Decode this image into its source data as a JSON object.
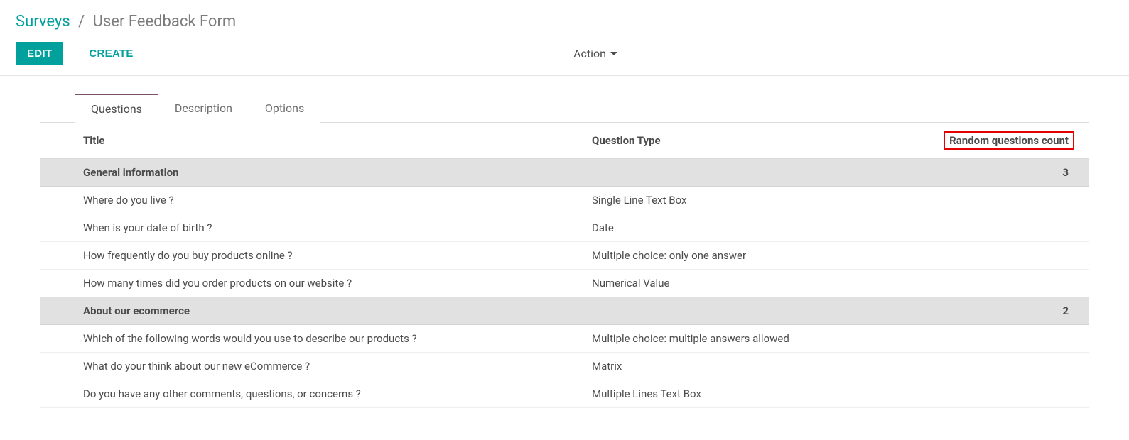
{
  "breadcrumb": {
    "parent": "Surveys",
    "current": "User Feedback Form"
  },
  "toolbar": {
    "edit_label": "EDIT",
    "create_label": "CREATE",
    "action_label": "Action"
  },
  "tabs": {
    "questions": "Questions",
    "description": "Description",
    "options": "Options"
  },
  "table": {
    "headers": {
      "title": "Title",
      "question_type": "Question Type",
      "random_count": "Random questions count"
    },
    "sections": [
      {
        "name": "General information",
        "random_count": "3",
        "rows": [
          {
            "title": "Where do you live ?",
            "type": "Single Line Text Box"
          },
          {
            "title": "When is your date of birth ?",
            "type": "Date"
          },
          {
            "title": "How frequently do you buy products online ?",
            "type": "Multiple choice: only one answer"
          },
          {
            "title": "How many times did you order products on our website ?",
            "type": "Numerical Value"
          }
        ]
      },
      {
        "name": "About our ecommerce",
        "random_count": "2",
        "rows": [
          {
            "title": "Which of the following words would you use to describe our products ?",
            "type": "Multiple choice: multiple answers allowed"
          },
          {
            "title": "What do your think about our new eCommerce ?",
            "type": "Matrix"
          },
          {
            "title": "Do you have any other comments, questions, or concerns ?",
            "type": "Multiple Lines Text Box"
          }
        ]
      }
    ]
  }
}
